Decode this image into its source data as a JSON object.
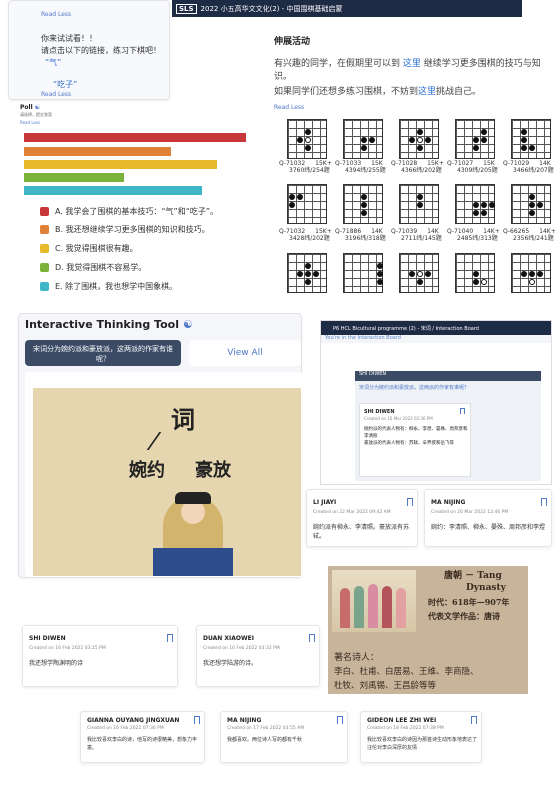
{
  "top_left": {
    "line1": "你来试试看！！",
    "line2": "请点击以下的链接，练习下棋吧！",
    "link1": "“气”",
    "link2": "“吃子”",
    "read_less": "Read Less"
  },
  "header": {
    "logo": "SLS",
    "title": "2022 小五高华文文化(2) - 中国围棋基础启蒙"
  },
  "extension": {
    "title": "伸展活动",
    "p1_a": "有兴趣的同学，在假期里可以到",
    "p1_link": "这里",
    "p1_b": "继续学习更多围棋的技巧与知识。",
    "p2_a": "如果同学们还想多练习围棋，不妨到",
    "p2_link": "这里",
    "p2_b": "挑战自己。",
    "read_less": "Read Less"
  },
  "poll": {
    "title": "Poll",
    "subtitle": "请选择，提交答案",
    "read_less": "Read Less",
    "colors": [
      "#c8383a",
      "#e0813a",
      "#e8b92a",
      "#7bb33a",
      "#3fb6c7"
    ],
    "results": [
      1.0,
      0.66,
      0.87,
      0.45,
      0.8
    ],
    "options": [
      "A. 我学会了围棋的基本技巧：“气”和“吃子”。",
      "B. 我还想继续学习更多围棋的知识和技巧。",
      "C. 我觉得围棋很有趣。",
      "D. 我觉得围棋不容易学。",
      "E. 除了围棋，我也想学中国象棋。"
    ]
  },
  "go_problems": [
    {
      "id": "Q-71032",
      "rank": "15K+",
      "stats": "3760纬/254题"
    },
    {
      "id": "Q-71033",
      "rank": "15K",
      "stats": "4394纬/255题"
    },
    {
      "id": "Q-71028",
      "rank": "15K+",
      "stats": "4366纬/202题"
    },
    {
      "id": "Q-71027",
      "rank": "15K",
      "stats": "4309纬/205题"
    },
    {
      "id": "Q-71029",
      "rank": "14K",
      "stats": "3466纬/207题"
    },
    {
      "id": "Q-71032",
      "rank": "15K+",
      "stats": "3428纬/202题"
    },
    {
      "id": "Q-71886",
      "rank": "14K",
      "stats": "3196纬/318题"
    },
    {
      "id": "Q-71039",
      "rank": "14K",
      "stats": "2711纬/145题"
    },
    {
      "id": "Q-71040",
      "rank": "14K+",
      "stats": "2485纬/313题"
    },
    {
      "id": "Q-66265",
      "rank": "14K+",
      "stats": "2356纬/241题"
    }
  ],
  "itt": {
    "title": "Interactive Thinking Tool",
    "question": "宋词分为婉约派和豪放派，这两派的作家有谁呢？",
    "view_all": "View All",
    "img_top": "词",
    "img_left": "婉约",
    "img_right": "豪放"
  },
  "board": {
    "header": "P6 HCL Bicultural programme (2) - 宋词 / Interaction Board",
    "sub": "You're in the Interaction Board",
    "section": "SHI DIWEN",
    "question": "宋词分为婉约派和豪放派，这两派的作家有谁呢？",
    "post_name": "SHI DIWEN",
    "post_date": "Created on 16 Mar 2022 02:36 PM",
    "post_text": "婉约派的代表人物有：柳永、李煜、晏殊、周邦彦和李清照\n豪放派的代表人物有：苏轼、辛弃疾和岳飞等"
  },
  "cards": [
    {
      "name": "LI JIAYI",
      "date": "Created on 22 Mar 2022 09:42 AM",
      "text": "婉约派有柳永、李清照。豪放派有苏轼。"
    },
    {
      "name": "MA NIJING",
      "date": "Created on 20 Mar 2022 12:46 PM",
      "text": "婉约：李清照、柳永、晏殊、周邦彦和李煜"
    },
    {
      "name": "SHI DIWEN",
      "date": "Created on 16 Feb 2022 03:25 PM",
      "text": "我还想学陶渊明的诗"
    },
    {
      "name": "DUAN XIAOWEI",
      "date": "Created on 16 Feb 2022 03:32 PM",
      "text": "我还想学陆游的诗。"
    },
    {
      "name": "GIANNA OUYANG JINGXUAN",
      "date": "Created on 16 Feb 2022 07:36 PM",
      "text": "我比较喜欢李白的诗，他写的诗很精美，想象力丰富。"
    },
    {
      "name": "MA NIJING",
      "date": "Created on 17 Feb 2022 03:55 AM",
      "text": "我都喜欢。两位诗人写的都有千秋"
    },
    {
      "name": "GIDEON LEE ZHI WEI",
      "date": "Created on 18 Feb 2022 07:38 PM",
      "text": "我比较喜欢李白的诗因为那首诗生动形象地表达了汪伦对李白深厚的友情"
    }
  ],
  "tang": {
    "title1": "唐朝 － Tang",
    "title2": "Dynasty",
    "time": "时代：618年—907年",
    "rep": "代表文学作品：唐诗",
    "poets_label": "著名诗人：",
    "poets1": "李白、杜甫、白居易、王维、李商隐、",
    "poets2": "杜牧、刘禹锡、王昌龄等等"
  }
}
